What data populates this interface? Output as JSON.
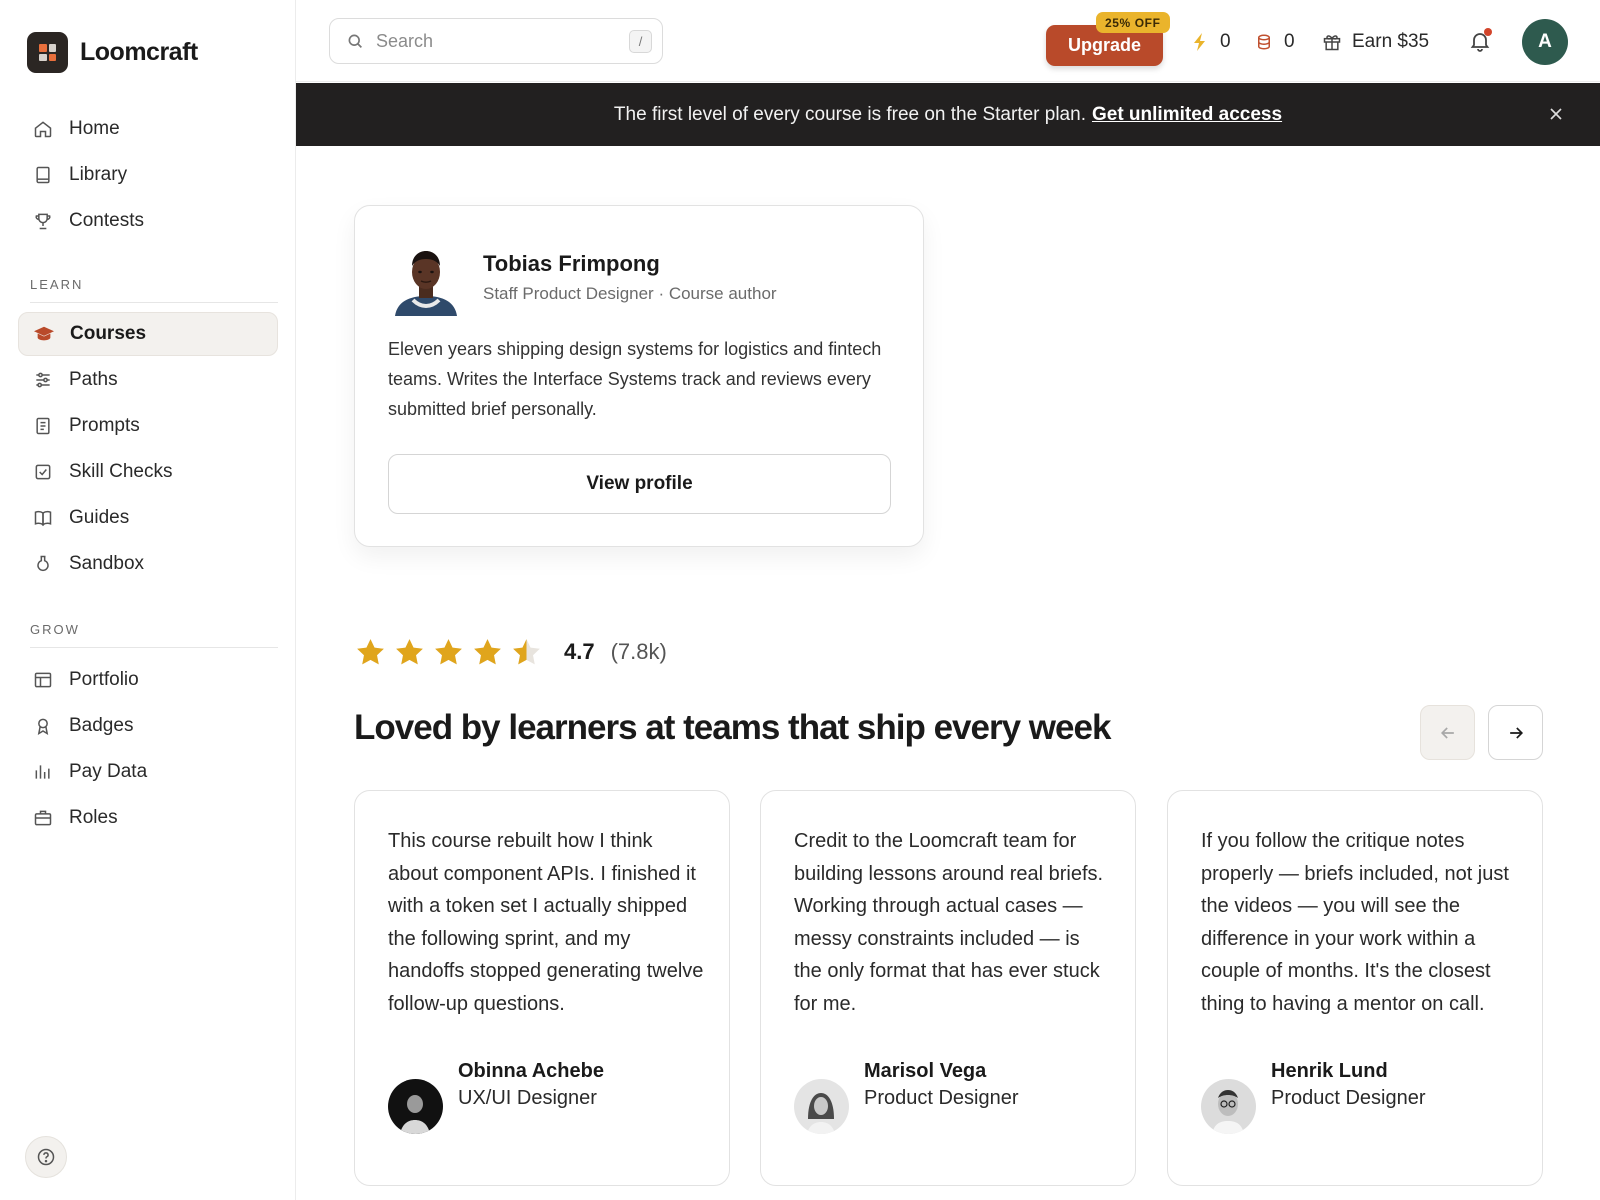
{
  "brand": {
    "name": "Loomcraft",
    "logo_colors": [
      "#e86f3c",
      "#d8d2cc",
      "#d8d2cc",
      "#e86f3c"
    ]
  },
  "sidebar": {
    "main_items": [
      {
        "label": "Home",
        "icon": "home-icon"
      },
      {
        "label": "Library",
        "icon": "book-icon"
      },
      {
        "label": "Contests",
        "icon": "trophy-icon"
      }
    ],
    "learn_label": "LEARN",
    "learn_items": [
      {
        "label": "Courses",
        "icon": "graduation-cap-icon",
        "active": true
      },
      {
        "label": "Paths",
        "icon": "sliders-icon"
      },
      {
        "label": "Prompts",
        "icon": "document-icon"
      },
      {
        "label": "Skill Checks",
        "icon": "checkbox-icon"
      },
      {
        "label": "Guides",
        "icon": "open-book-icon"
      },
      {
        "label": "Sandbox",
        "icon": "flask-icon"
      }
    ],
    "grow_label": "GROW",
    "grow_items": [
      {
        "label": "Portfolio",
        "icon": "layout-icon"
      },
      {
        "label": "Badges",
        "icon": "badge-icon"
      },
      {
        "label": "Pay Data",
        "icon": "bar-chart-icon"
      },
      {
        "label": "Roles",
        "icon": "briefcase-icon"
      }
    ]
  },
  "topbar": {
    "search_placeholder": "Search",
    "search_shortcut": "/",
    "upgrade_label": "Upgrade",
    "discount_badge": "25% OFF",
    "energy_count": "0",
    "coins_count": "0",
    "earn_label": "Earn $35",
    "avatar_initial": "A"
  },
  "banner": {
    "text": "The first level of every course is free on the Starter plan.",
    "link": "Get unlimited access"
  },
  "author": {
    "name": "Tobias Frimpong",
    "role": "Staff Product Designer · Course author",
    "bio": "Eleven years shipping design systems for logistics and fintech teams. Writes the Interface Systems track and reviews every submitted brief personally.",
    "button": "View profile"
  },
  "rating": {
    "value": "4.7",
    "count": "(7.8k)",
    "stars": 4.5
  },
  "testimonials": {
    "headline": "Loved by learners at teams that ship every week",
    "items": [
      {
        "quote": "This course rebuilt how I think about component APIs. I finished it with a token set I actually shipped the following sprint, and my handoffs stopped generating twelve follow-up questions.",
        "name": "Obinna Achebe",
        "role": "UX/UI Designer"
      },
      {
        "quote": "Credit to the Loomcraft team for building lessons around real briefs. Working through actual cases — messy constraints included — is the only format that has ever stuck for me.",
        "name": "Marisol Vega",
        "role": "Product Designer"
      },
      {
        "quote": "If you follow the critique notes properly — briefs included, not just the videos — you will see the difference in your work within a couple of months. It's the closest thing to having a mentor on call.",
        "name": "Henrik Lund",
        "role": "Product Designer"
      }
    ]
  },
  "colors": {
    "accent": "#b94a2a",
    "badge": "#eab42c",
    "star": "#e0a51c",
    "banner_bg": "#222020",
    "avatar_bg": "#2e5a4e"
  }
}
